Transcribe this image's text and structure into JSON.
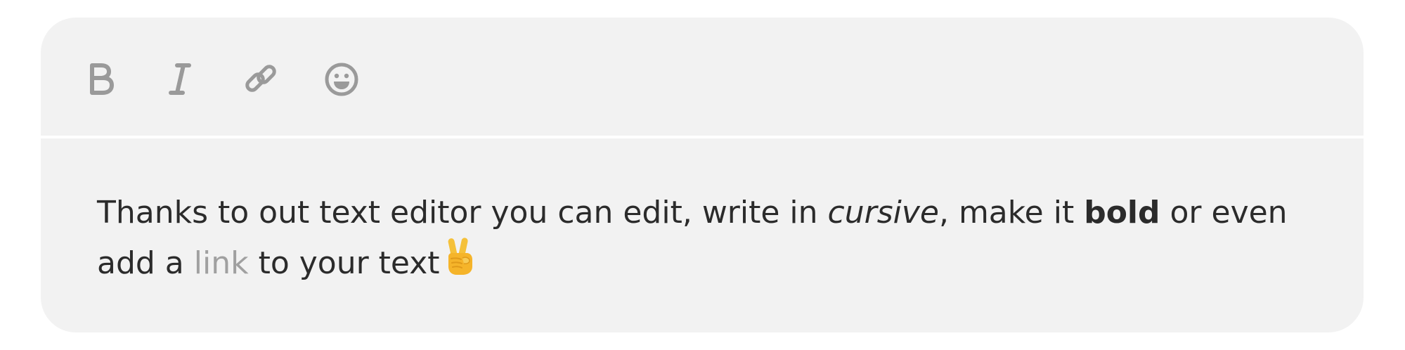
{
  "toolbar": {
    "buttons": [
      {
        "name": "bold",
        "icon": "bold-icon"
      },
      {
        "name": "italic",
        "icon": "italic-icon"
      },
      {
        "name": "link",
        "icon": "link-icon"
      },
      {
        "name": "emoji",
        "icon": "smiley-icon"
      }
    ],
    "icon_color": "#9a9a9a"
  },
  "editor": {
    "background": "#f2f2f2",
    "text_color": "#2b2b2b",
    "link_color": "#a0a0a0",
    "content": {
      "part1": "Thanks to out text editor you can edit, write in ",
      "italic": "cursive",
      "part2": ", make it ",
      "bold": "bold",
      "part3": " or even add a ",
      "link": "link",
      "part4": " to your text",
      "emoji_icon": "victory-hand-emoji"
    }
  }
}
